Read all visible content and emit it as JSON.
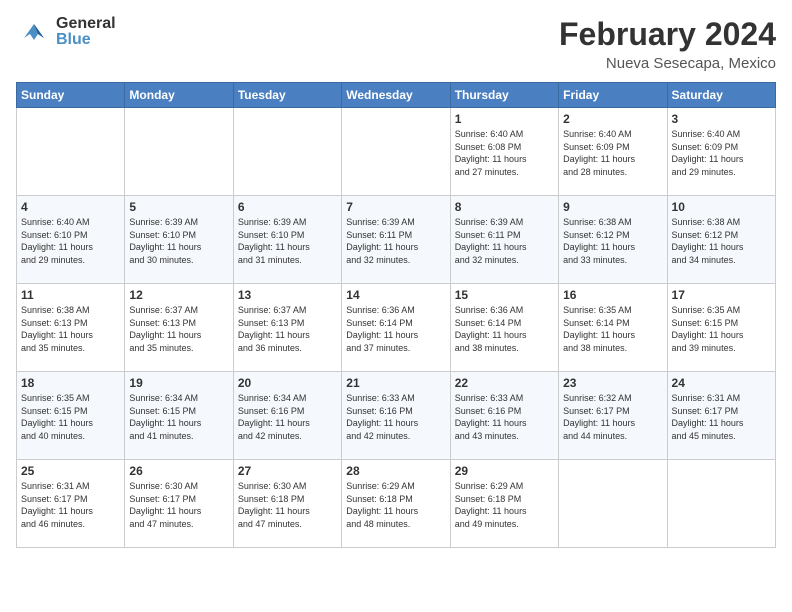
{
  "header": {
    "logo_general": "General",
    "logo_blue": "Blue",
    "month_year": "February 2024",
    "location": "Nueva Sesecapa, Mexico"
  },
  "calendar": {
    "days_of_week": [
      "Sunday",
      "Monday",
      "Tuesday",
      "Wednesday",
      "Thursday",
      "Friday",
      "Saturday"
    ],
    "weeks": [
      [
        {
          "day": "",
          "info": ""
        },
        {
          "day": "",
          "info": ""
        },
        {
          "day": "",
          "info": ""
        },
        {
          "day": "",
          "info": ""
        },
        {
          "day": "1",
          "info": "Sunrise: 6:40 AM\nSunset: 6:08 PM\nDaylight: 11 hours\nand 27 minutes."
        },
        {
          "day": "2",
          "info": "Sunrise: 6:40 AM\nSunset: 6:09 PM\nDaylight: 11 hours\nand 28 minutes."
        },
        {
          "day": "3",
          "info": "Sunrise: 6:40 AM\nSunset: 6:09 PM\nDaylight: 11 hours\nand 29 minutes."
        }
      ],
      [
        {
          "day": "4",
          "info": "Sunrise: 6:40 AM\nSunset: 6:10 PM\nDaylight: 11 hours\nand 29 minutes."
        },
        {
          "day": "5",
          "info": "Sunrise: 6:39 AM\nSunset: 6:10 PM\nDaylight: 11 hours\nand 30 minutes."
        },
        {
          "day": "6",
          "info": "Sunrise: 6:39 AM\nSunset: 6:10 PM\nDaylight: 11 hours\nand 31 minutes."
        },
        {
          "day": "7",
          "info": "Sunrise: 6:39 AM\nSunset: 6:11 PM\nDaylight: 11 hours\nand 32 minutes."
        },
        {
          "day": "8",
          "info": "Sunrise: 6:39 AM\nSunset: 6:11 PM\nDaylight: 11 hours\nand 32 minutes."
        },
        {
          "day": "9",
          "info": "Sunrise: 6:38 AM\nSunset: 6:12 PM\nDaylight: 11 hours\nand 33 minutes."
        },
        {
          "day": "10",
          "info": "Sunrise: 6:38 AM\nSunset: 6:12 PM\nDaylight: 11 hours\nand 34 minutes."
        }
      ],
      [
        {
          "day": "11",
          "info": "Sunrise: 6:38 AM\nSunset: 6:13 PM\nDaylight: 11 hours\nand 35 minutes."
        },
        {
          "day": "12",
          "info": "Sunrise: 6:37 AM\nSunset: 6:13 PM\nDaylight: 11 hours\nand 35 minutes."
        },
        {
          "day": "13",
          "info": "Sunrise: 6:37 AM\nSunset: 6:13 PM\nDaylight: 11 hours\nand 36 minutes."
        },
        {
          "day": "14",
          "info": "Sunrise: 6:36 AM\nSunset: 6:14 PM\nDaylight: 11 hours\nand 37 minutes."
        },
        {
          "day": "15",
          "info": "Sunrise: 6:36 AM\nSunset: 6:14 PM\nDaylight: 11 hours\nand 38 minutes."
        },
        {
          "day": "16",
          "info": "Sunrise: 6:35 AM\nSunset: 6:14 PM\nDaylight: 11 hours\nand 38 minutes."
        },
        {
          "day": "17",
          "info": "Sunrise: 6:35 AM\nSunset: 6:15 PM\nDaylight: 11 hours\nand 39 minutes."
        }
      ],
      [
        {
          "day": "18",
          "info": "Sunrise: 6:35 AM\nSunset: 6:15 PM\nDaylight: 11 hours\nand 40 minutes."
        },
        {
          "day": "19",
          "info": "Sunrise: 6:34 AM\nSunset: 6:15 PM\nDaylight: 11 hours\nand 41 minutes."
        },
        {
          "day": "20",
          "info": "Sunrise: 6:34 AM\nSunset: 6:16 PM\nDaylight: 11 hours\nand 42 minutes."
        },
        {
          "day": "21",
          "info": "Sunrise: 6:33 AM\nSunset: 6:16 PM\nDaylight: 11 hours\nand 42 minutes."
        },
        {
          "day": "22",
          "info": "Sunrise: 6:33 AM\nSunset: 6:16 PM\nDaylight: 11 hours\nand 43 minutes."
        },
        {
          "day": "23",
          "info": "Sunrise: 6:32 AM\nSunset: 6:17 PM\nDaylight: 11 hours\nand 44 minutes."
        },
        {
          "day": "24",
          "info": "Sunrise: 6:31 AM\nSunset: 6:17 PM\nDaylight: 11 hours\nand 45 minutes."
        }
      ],
      [
        {
          "day": "25",
          "info": "Sunrise: 6:31 AM\nSunset: 6:17 PM\nDaylight: 11 hours\nand 46 minutes."
        },
        {
          "day": "26",
          "info": "Sunrise: 6:30 AM\nSunset: 6:17 PM\nDaylight: 11 hours\nand 47 minutes."
        },
        {
          "day": "27",
          "info": "Sunrise: 6:30 AM\nSunset: 6:18 PM\nDaylight: 11 hours\nand 47 minutes."
        },
        {
          "day": "28",
          "info": "Sunrise: 6:29 AM\nSunset: 6:18 PM\nDaylight: 11 hours\nand 48 minutes."
        },
        {
          "day": "29",
          "info": "Sunrise: 6:29 AM\nSunset: 6:18 PM\nDaylight: 11 hours\nand 49 minutes."
        },
        {
          "day": "",
          "info": ""
        },
        {
          "day": "",
          "info": ""
        }
      ]
    ]
  }
}
